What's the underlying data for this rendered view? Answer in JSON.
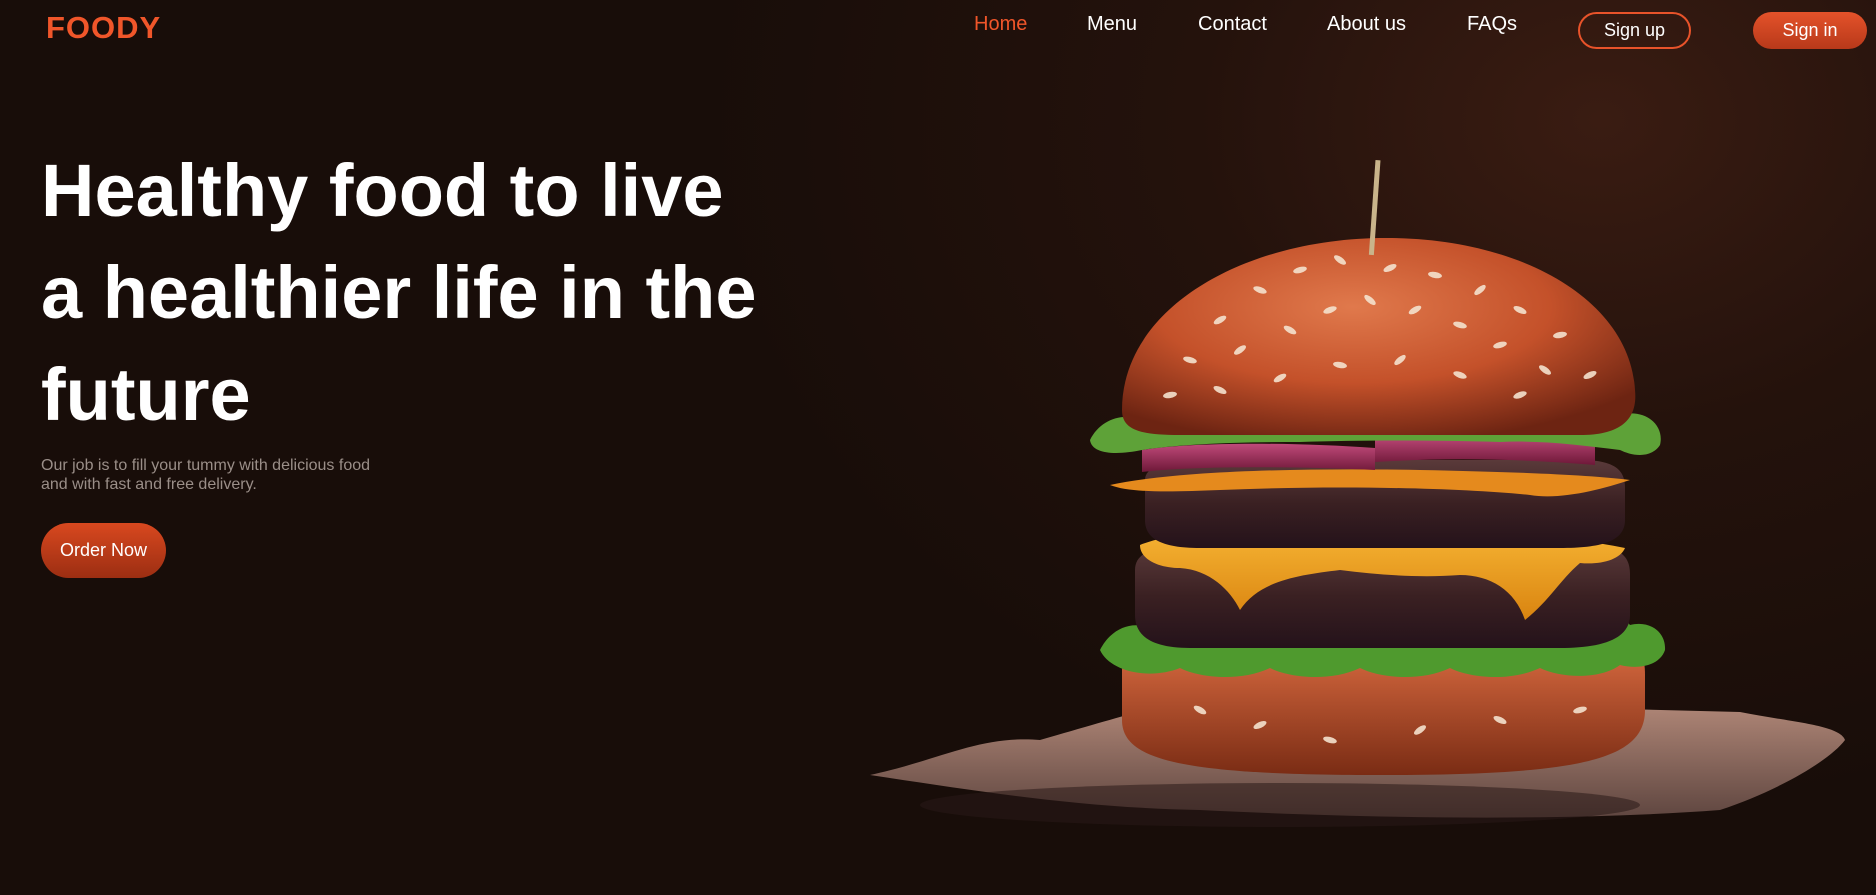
{
  "brand": {
    "logo": "FOODY",
    "accent": "#f0562a"
  },
  "nav": {
    "items": [
      {
        "label": "Home",
        "active": true
      },
      {
        "label": "Menu",
        "active": false
      },
      {
        "label": "Contact",
        "active": false
      },
      {
        "label": "About us",
        "active": false
      },
      {
        "label": "FAQs",
        "active": false
      }
    ],
    "signup_label": "Sign up",
    "signin_label": "Sign in"
  },
  "hero": {
    "title_line1": "Healthy food to live",
    "title_line2": "a healthier life in the",
    "title_line3": "future",
    "subtitle_line1": "Our job is to fill your tummy with delicious food",
    "subtitle_line2": "and with fast and free delivery.",
    "cta_label": "Order Now"
  },
  "image": {
    "subject": "burger-illustration"
  }
}
